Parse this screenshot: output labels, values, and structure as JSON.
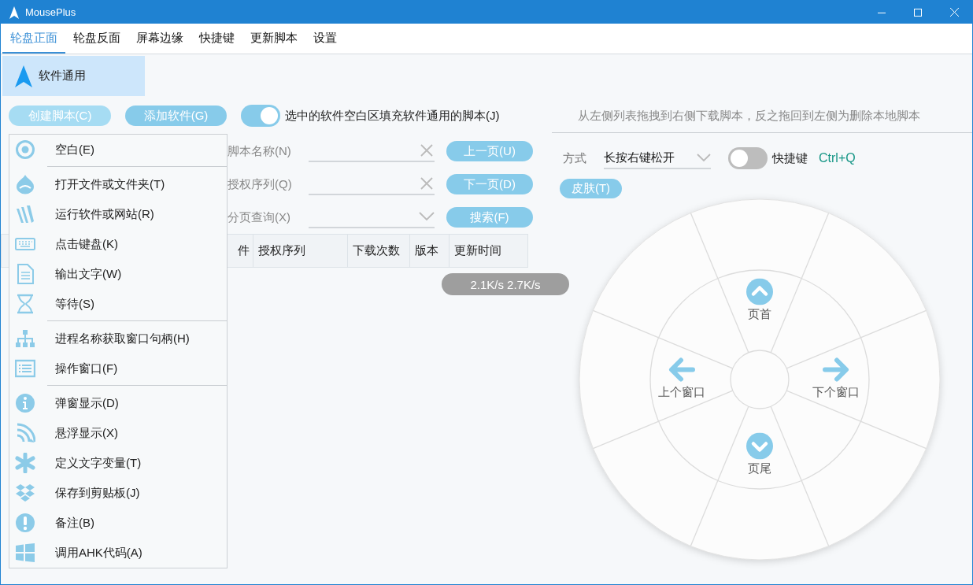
{
  "window": {
    "title": "MousePlus"
  },
  "tabs": [
    {
      "label": "轮盘正面",
      "selected": true
    },
    {
      "label": "轮盘反面",
      "selected": false
    },
    {
      "label": "屏幕边缘",
      "selected": false
    },
    {
      "label": "快捷键",
      "selected": false
    },
    {
      "label": "更新脚本",
      "selected": false
    },
    {
      "label": "设置",
      "selected": false
    }
  ],
  "sidebar": {
    "items": [
      {
        "label": "软件通用",
        "selected": true
      }
    ]
  },
  "toolbar": {
    "create_button": "创建脚本(C)",
    "add_button": "添加软件(G)",
    "fill_toggle": {
      "label": "选中的软件空白区填充软件通用的脚本(J)",
      "on": true
    },
    "hint": "从左侧列表拖拽到右侧下载脚本，反之拖回到左侧为删除本地脚本"
  },
  "search_form": {
    "fields": [
      {
        "label": "脚本名称(N)",
        "kind": "text",
        "button": "上一页(U)"
      },
      {
        "label": "授权序列(Q)",
        "kind": "text",
        "button": "下一页(D)"
      },
      {
        "label": "分页查询(X)",
        "kind": "dropdown",
        "button": "搜索(F)"
      }
    ]
  },
  "table": {
    "columns": [
      "件",
      "授权序列",
      "下载次数",
      "版本",
      "更新时间"
    ]
  },
  "speed_badge": "2.1K/s 2.7K/s",
  "menu": {
    "groups": [
      [
        "空白(E)"
      ],
      [
        "打开文件或文件夹(T)",
        "运行软件或网站(R)",
        "点击键盘(K)",
        "输出文字(W)",
        "等待(S)"
      ],
      [
        "进程名称获取窗口句柄(H)",
        "操作窗口(F)"
      ],
      [
        "弹窗显示(D)",
        "悬浮显示(X)",
        "定义文字变量(T)",
        "保存到剪贴板(J)",
        "备注(B)",
        "调用AHK代码(A)"
      ]
    ]
  },
  "wheel_settings": {
    "mode_label": "方式",
    "mode_value": "长按右键松开",
    "shortcut_toggle": {
      "label": "快捷键",
      "on": false
    },
    "shortcut": "Ctrl+Q",
    "skin_button": "皮肤(T)"
  },
  "wheel": {
    "items": [
      {
        "label": "页首",
        "kind": "up"
      },
      {
        "label": "下个窗口",
        "kind": "right"
      },
      {
        "label": "页尾",
        "kind": "down"
      },
      {
        "label": "上个窗口",
        "kind": "left"
      }
    ]
  }
}
